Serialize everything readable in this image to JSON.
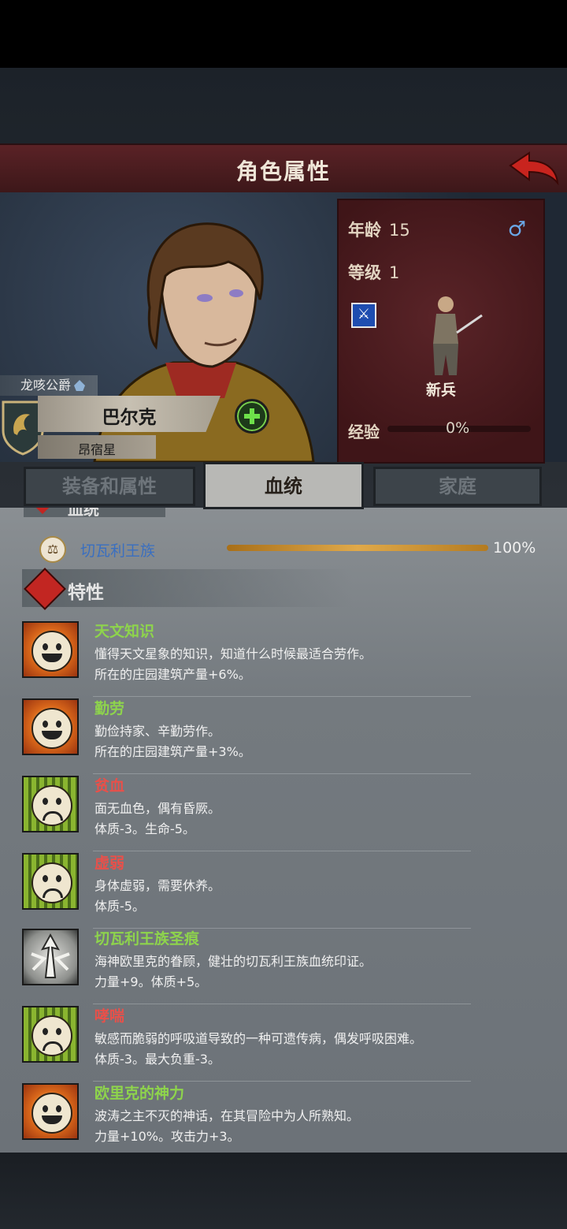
{
  "header": {
    "title": "角色属性",
    "back_icon": "back-arrow-icon"
  },
  "character": {
    "title_tag": "龙咳公爵",
    "name": "巴尔克",
    "constellation": "昂宿星",
    "age_label": "年龄",
    "age": "15",
    "level_label": "等级",
    "level": "1",
    "gender_icon": "male-icon",
    "class_name": "新兵",
    "exp_label": "经验",
    "exp_value": "0%"
  },
  "tabs": [
    {
      "label": "装备和属性",
      "active": false
    },
    {
      "label": "血统",
      "active": true
    },
    {
      "label": "家庭",
      "active": false
    }
  ],
  "lineage": {
    "header_cut": "血统",
    "name": "切瓦利王族",
    "percent": "100%",
    "fill": 1.0
  },
  "traits_section": {
    "title": "特性"
  },
  "traits": [
    {
      "name": "天文知识",
      "desc": "懂得天文星象的知识，知道什么时候最适合劳作。",
      "effect": "所在的庄园建筑产量+6%。",
      "kind": "good"
    },
    {
      "name": "勤劳",
      "desc": "勤俭持家、辛勤劳作。",
      "effect": "所在的庄园建筑产量+3%。",
      "kind": "good"
    },
    {
      "name": "贫血",
      "desc": "面无血色，偶有昏厥。",
      "effect": "体质-3。生命-5。",
      "kind": "bad"
    },
    {
      "name": "虚弱",
      "desc": "身体虚弱，需要休养。",
      "effect": "体质-5。",
      "kind": "bad"
    },
    {
      "name": "切瓦利王族圣痕",
      "desc": "海神欧里克的眷顾，健壮的切瓦利王族血统印证。",
      "effect": "力量+9。体质+5。",
      "kind": "special"
    },
    {
      "name": "哮喘",
      "desc": "敏感而脆弱的呼吸道导致的一种可遗传病，偶发呼吸困难。",
      "effect": "体质-3。最大负重-3。",
      "kind": "bad"
    },
    {
      "name": "欧里克的神力",
      "desc": "波涛之主不灭的神话，在其冒险中为人所熟知。",
      "effect": "力量+10%。攻击力+3。",
      "kind": "good"
    }
  ]
}
